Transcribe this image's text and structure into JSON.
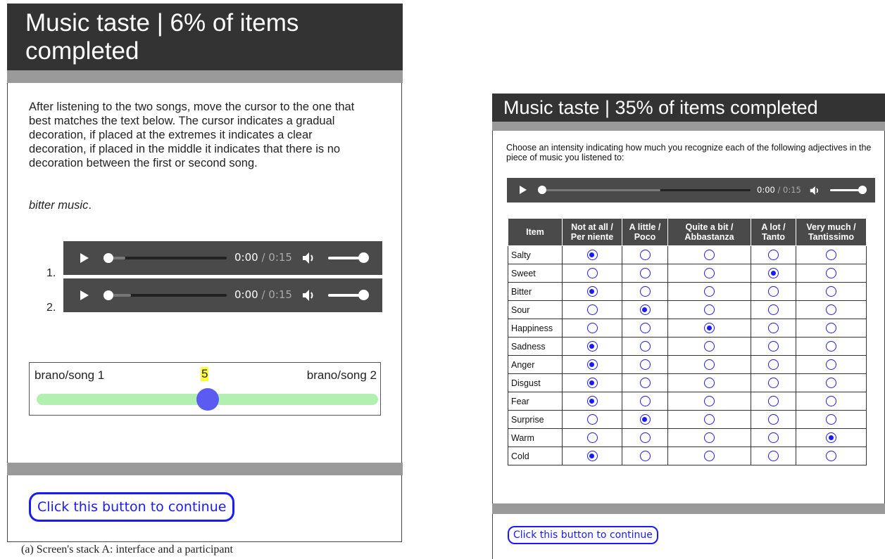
{
  "left": {
    "header_title": "Music taste | 6% of items completed",
    "progress_percent": 6,
    "instructions": "After listening to the two songs, move the cursor to the one that best matches the text below. The cursor indicates a gradual decoration, if placed at the extremes it indicates a clear decoration, if placed in the middle it indicates that there is no decoration between the first or second song.",
    "prompt": "bitter music",
    "prompt_suffix": ".",
    "players": [
      {
        "number": "1.",
        "current": "0:00",
        "separator": " / ",
        "duration": "0:15"
      },
      {
        "number": "2.",
        "current": "0:00",
        "separator": " / ",
        "duration": "0:15"
      }
    ],
    "scale": {
      "left_label": "brano/song 1",
      "right_label": "brano/song 2",
      "value": "5",
      "min": 0,
      "max": 10
    },
    "continue_button": "Click this button to continue"
  },
  "caption": "(a) Screen's stack A: interface and a participant",
  "right": {
    "header_title": "Music taste | 35% of items completed",
    "progress_percent": 35,
    "instructions": "Choose an intensity indicating how much you recognize each of the following adjectives in the piece of music you listened to:",
    "player": {
      "current": "0:00",
      "separator": " / ",
      "duration": "0:15"
    },
    "table": {
      "item_header": "Item",
      "columns": [
        {
          "line1": "Not at all /",
          "line2": "Per niente"
        },
        {
          "line1": "A little /",
          "line2": "Poco"
        },
        {
          "line1": "Quite a bit /",
          "line2": "Abbastanza"
        },
        {
          "line1": "A lot /",
          "line2": "Tanto"
        },
        {
          "line1": "Very much /",
          "line2": "Tantissimo"
        }
      ],
      "rows": [
        {
          "item": "Salty",
          "selected": 0
        },
        {
          "item": "Sweet",
          "selected": 3
        },
        {
          "item": "Bitter",
          "selected": 0
        },
        {
          "item": "Sour",
          "selected": 1
        },
        {
          "item": "Happiness",
          "selected": 2
        },
        {
          "item": "Sadness",
          "selected": 0
        },
        {
          "item": "Anger",
          "selected": 0
        },
        {
          "item": "Disgust",
          "selected": 0
        },
        {
          "item": "Fear",
          "selected": 0
        },
        {
          "item": "Surprise",
          "selected": 1
        },
        {
          "item": "Warm",
          "selected": 4
        },
        {
          "item": "Cold",
          "selected": 0
        }
      ]
    },
    "continue_button": "Click this button to continue"
  },
  "colors": {
    "header_bg": "#333333",
    "divider": "#9a9a9a",
    "accent_blue": "#1a1aff",
    "slider_track": "#b2f0b2",
    "slider_thumb": "#5b5bf4",
    "value_highlight": "#ffff33"
  },
  "icons": [
    "play-icon",
    "volume-icon",
    "radio-button"
  ]
}
